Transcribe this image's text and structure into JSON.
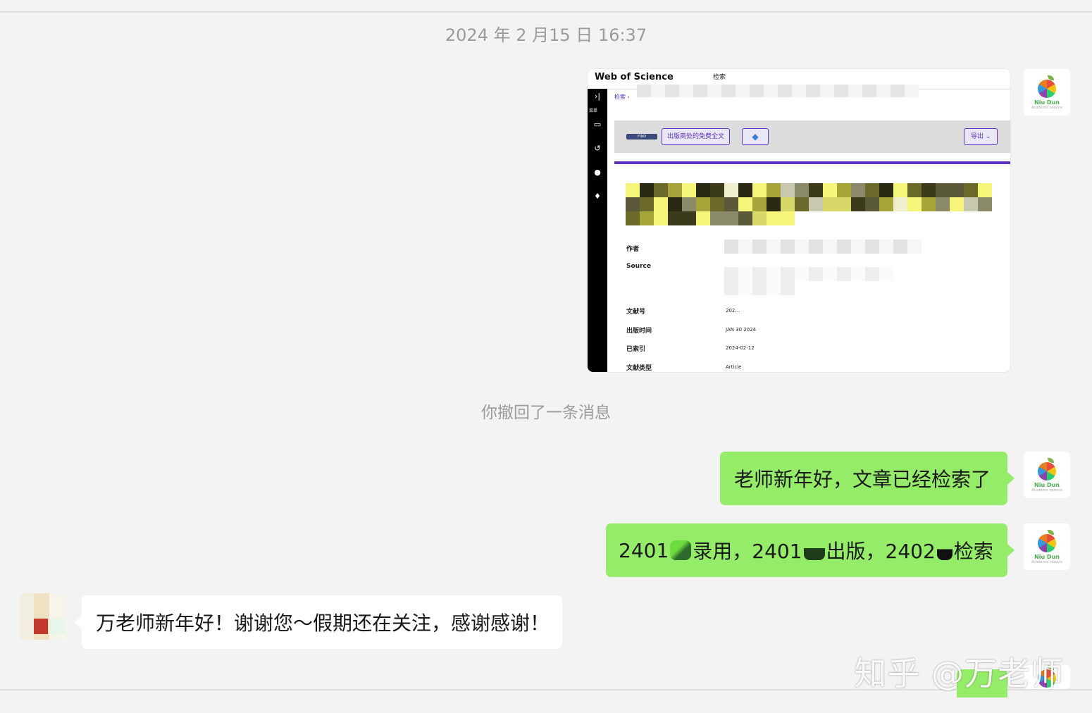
{
  "chat": {
    "timestamp": "2024 年 2 月15 日 16:37",
    "recall_notice": "你撤回了一条消息",
    "avatar_self": {
      "name": "Niu Dun",
      "sub": "Academic service"
    },
    "messages": {
      "m1": "老师新年好，文章已经检索了",
      "m2": {
        "p1": "2401",
        "p2": "录用，2401",
        "p3": "出版，2402",
        "p4": "检索"
      },
      "m3": "万老师新年好！谢谢您～假期还在关注，感谢感谢！"
    },
    "colors": {
      "bubble_self": "#95ec69",
      "bubble_other": "#ffffff",
      "background": "#f3f3f3"
    }
  },
  "screenshot": {
    "logo": "Web of Science",
    "tab": "检索",
    "breadcrumb": "检索 ›",
    "side_menu": "菜单",
    "find_button": "FIND",
    "free_fulltext_button": "出版商处的免费全文",
    "export_button": "导出 ⌄",
    "fields": [
      {
        "label": "作者",
        "value": ""
      },
      {
        "label": "Source",
        "value": ""
      },
      {
        "label": "文献号",
        "value": "202…"
      },
      {
        "label": "出版时间",
        "value": "JAN 30 2024"
      },
      {
        "label": "已索引",
        "value": "2024-02-12"
      },
      {
        "label": "文献类型",
        "value": "Article"
      }
    ]
  },
  "watermark": "知乎 @万老师"
}
